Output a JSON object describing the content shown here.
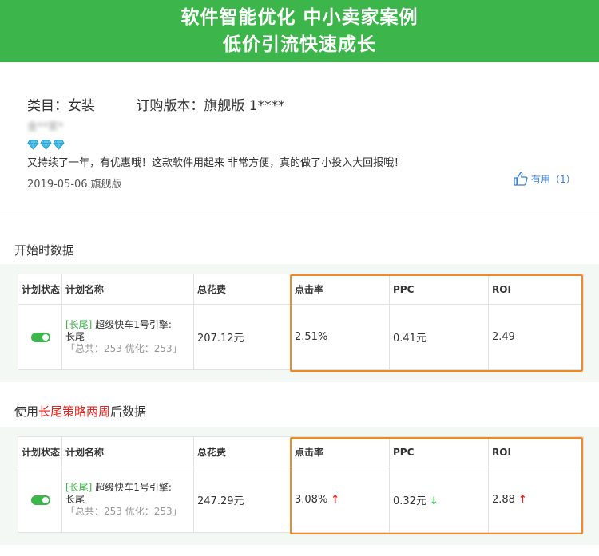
{
  "banner": {
    "line1": "软件智能优化  中小卖家案例",
    "line2": "低价引流快速成长"
  },
  "review": {
    "category": "类目：女装",
    "version": "订购版本：旗舰版 1****",
    "user": "金**家*",
    "gem_count": 3,
    "comment": "又持续了一年，有优惠哦！这款软件用起来 非常方便，真的做了小投入大回报哦！",
    "date": "2019-05-06 旗舰版",
    "useful": "有用（1）"
  },
  "section1": {
    "title": "开始时数据",
    "headers": [
      "计划状态",
      "计划名称",
      "总花费",
      "点击率",
      "PPC",
      "ROI"
    ],
    "row": {
      "tag": "[长尾]",
      "name": " 超级快车1号引擎:",
      "name2": "长尾",
      "counts": "「总共：253  优化：253」",
      "cost": "207.12元",
      "ctr": "2.51%",
      "ppc": "0.41元",
      "roi": "2.49"
    }
  },
  "section2": {
    "title_prefix": "使用",
    "title_highlight": "长尾策略两周",
    "title_suffix": "后数据",
    "headers": [
      "计划状态",
      "计划名称",
      "总花费",
      "点击率",
      "PPC",
      "ROI"
    ],
    "row": {
      "tag": "[长尾]",
      "name": " 超级快车1号引擎:",
      "name2": "长尾",
      "counts": "「总共：253  优化：253」",
      "cost": "247.29元",
      "ctr": "3.08%",
      "ctr_arrow": "↑",
      "ppc": "0.32元",
      "ppc_arrow": "↓",
      "roi": "2.88",
      "roi_arrow": "↑"
    }
  },
  "colors": {
    "brand_green": "#3cb64a",
    "highlight_orange": "#f08a24",
    "up_red": "#e8231e",
    "down_green": "#3cb64a",
    "link_blue": "#3a7fd5"
  }
}
